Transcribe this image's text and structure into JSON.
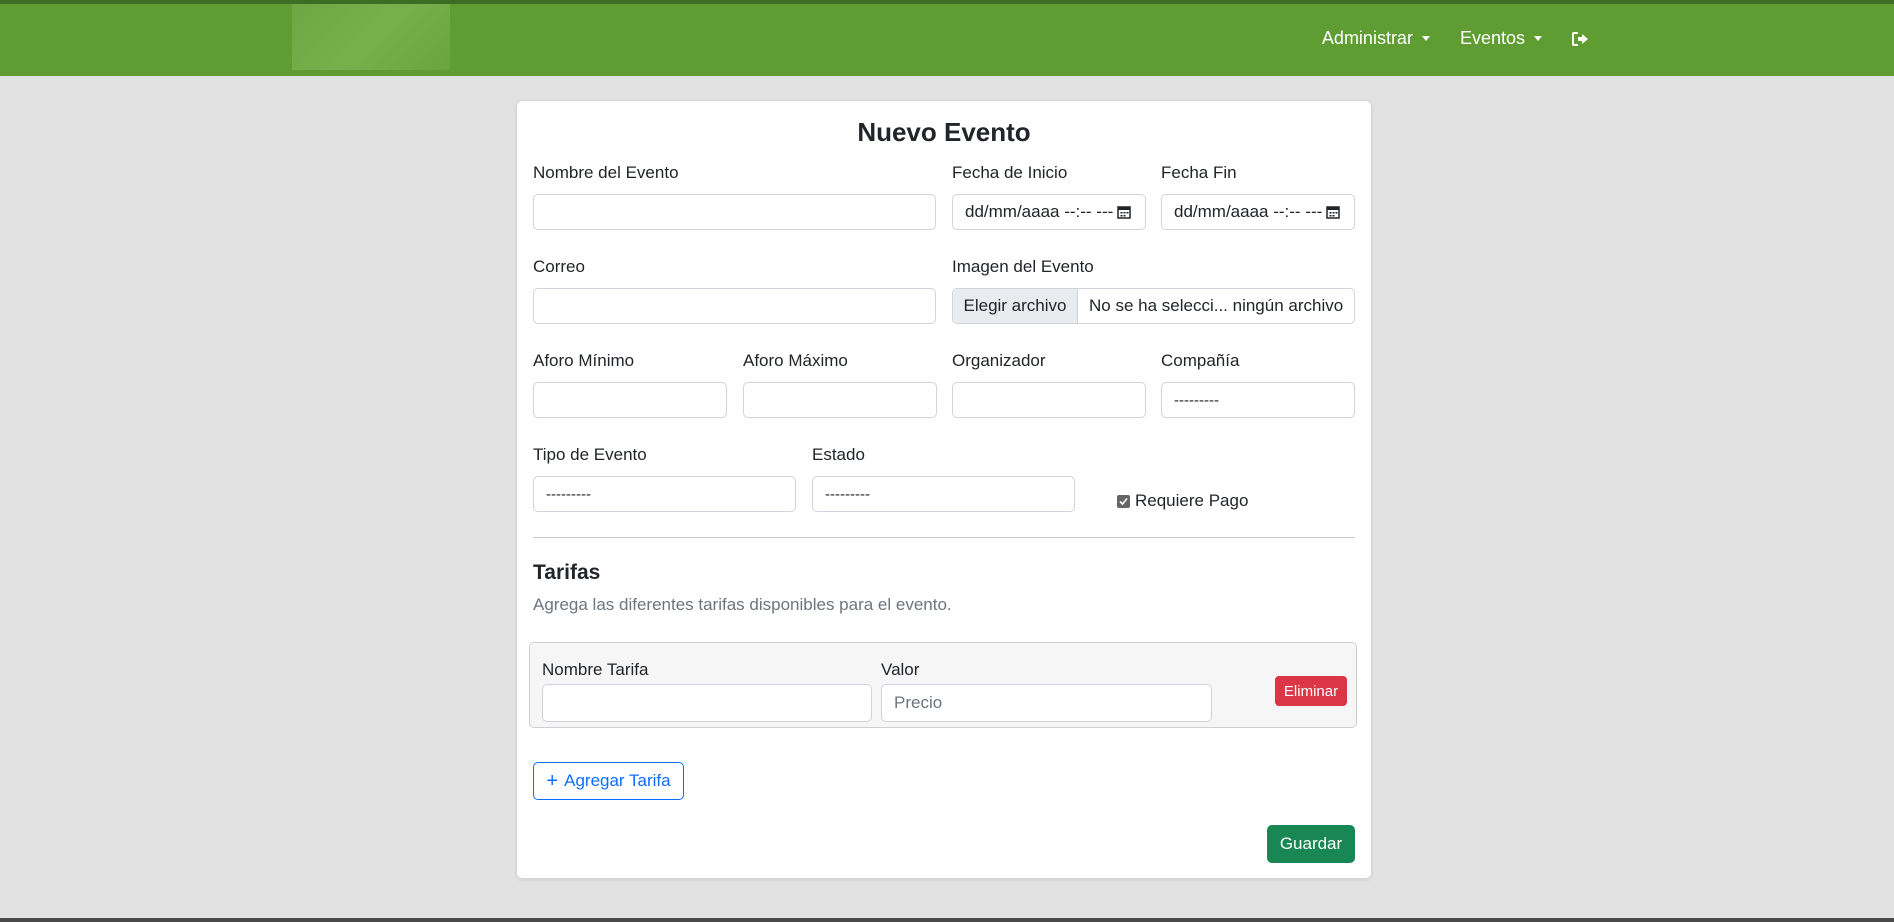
{
  "nav": {
    "items": [
      {
        "label": "Administrar"
      },
      {
        "label": "Eventos"
      }
    ],
    "logout_icon": "sign-out-icon"
  },
  "form": {
    "title": "Nuevo Evento",
    "fields": {
      "nombre": {
        "label": "Nombre del Evento",
        "value": ""
      },
      "fecha_inicio": {
        "label": "Fecha de Inicio",
        "value": "dd/mm/aaaa --:-- ---"
      },
      "fecha_fin": {
        "label": "Fecha Fin",
        "value": "dd/mm/aaaa --:-- ---"
      },
      "correo": {
        "label": "Correo",
        "value": ""
      },
      "imagen": {
        "label": "Imagen del Evento",
        "button": "Elegir archivo",
        "status": "No se ha selecci... ningún archivo"
      },
      "aforo_min": {
        "label": "Aforo Mínimo",
        "value": ""
      },
      "aforo_max": {
        "label": "Aforo Máximo",
        "value": ""
      },
      "organizador": {
        "label": "Organizador",
        "value": ""
      },
      "compania": {
        "label": "Compañía",
        "value": "---------"
      },
      "tipo_evento": {
        "label": "Tipo de Evento",
        "value": "---------"
      },
      "estado": {
        "label": "Estado",
        "value": "---------"
      },
      "requiere_pago": {
        "label": "Requiere Pago",
        "checked": true
      }
    },
    "tarifas": {
      "title": "Tarifas",
      "description": "Agrega las diferentes tarifas disponibles para el evento.",
      "row": {
        "nombre_label": "Nombre Tarifa",
        "nombre_value": "",
        "valor_label": "Valor",
        "valor_placeholder": "Precio",
        "delete_label": "Eliminar"
      },
      "add_label": "Agregar Tarifa"
    },
    "save_label": "Guardar"
  },
  "colors": {
    "navbar": "#5f9c32",
    "primary": "#0d6efd",
    "danger": "#dc3545",
    "success": "#198754"
  }
}
